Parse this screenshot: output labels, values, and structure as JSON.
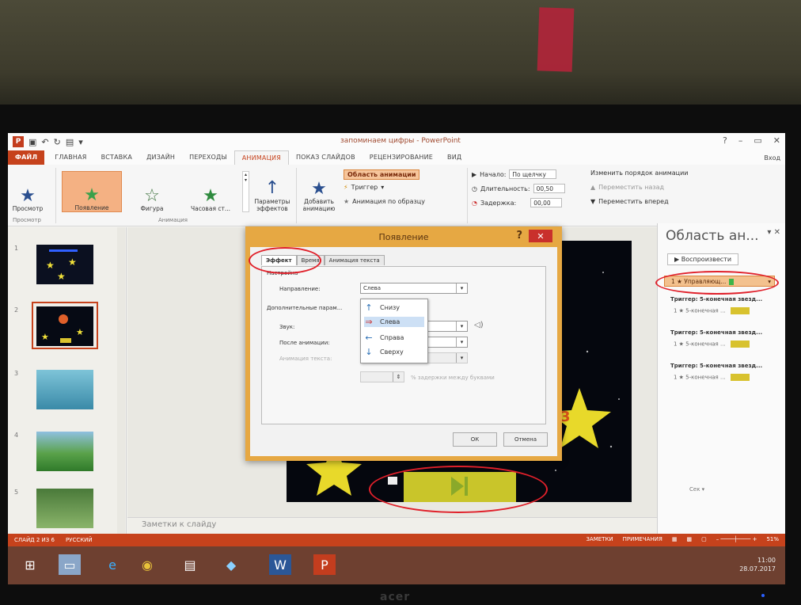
{
  "titlebar": {
    "doc_title": "запоминаем цифры - PowerPoint",
    "help": "?",
    "minimize": "–",
    "maximize": "▭",
    "close": "✕"
  },
  "tabs": {
    "file": "ФАЙЛ",
    "items": [
      "ГЛАВНАЯ",
      "ВСТАВКА",
      "ДИЗАЙН",
      "ПЕРЕХОДЫ",
      "АНИМАЦИЯ",
      "ПОКАЗ СЛАЙДОВ",
      "РЕЦЕНЗИРОВАНИЕ",
      "ВИД"
    ],
    "account": "Вход"
  },
  "ribbon": {
    "preview": "Просмотр",
    "preview_group": "Просмотр",
    "effects": [
      "Появление",
      "Фигура",
      "Часовая ст..."
    ],
    "animation_group": "Анимация",
    "effect_options": "Параметры эффектов",
    "add_animation": "Добавить анимацию",
    "animation_pane": "Область анимации",
    "trigger": "Триггер",
    "animation_painter": "Анимация по образцу",
    "start_label": "Начало:",
    "start_value": "По щелчку",
    "duration_label": "Длительность:",
    "duration_value": "00,50",
    "delay_label": "Задержка:",
    "delay_value": "00,00",
    "reorder_title": "Изменить порядок анимации",
    "move_earlier": "Переместить назад",
    "move_later": "Переместить вперед"
  },
  "slides": {
    "numbers": [
      "1",
      "2",
      "3",
      "4",
      "5"
    ],
    "selected_index": 2
  },
  "notes": {
    "placeholder": "Заметки к слайду"
  },
  "slide": {
    "star_label": "3"
  },
  "animation_pane": {
    "title": "Область ан...",
    "play": "Воспроизвести",
    "selected": "1 ★ Управляющ...",
    "triggers": [
      {
        "title": "Триггер: 5-конечная звезд...",
        "item": "1 ★ 5-конечная ..."
      },
      {
        "title": "Триггер: 5-конечная звезд...",
        "item": "1 ★ 5-конечная ..."
      },
      {
        "title": "Триггер: 5-конечная звезд...",
        "item": "1 ★ 5-конечная ..."
      }
    ],
    "bottom": "Сек ▾"
  },
  "dialog": {
    "title": "Появление",
    "tabs": [
      "Эффект",
      "Время",
      "Анимация текста"
    ],
    "settings_label": "Настройка",
    "direction_label": "Направление:",
    "direction_value": "Слева",
    "extra_label": "Дополнительные парам...",
    "sound_label": "Звук:",
    "after_label": "После анимации:",
    "animate_text_label": "Анимация текста:",
    "delay_text": "% задержки между буквами",
    "options": [
      "Снизу",
      "Слева",
      "Справа",
      "Сверху"
    ],
    "selected_option": 1,
    "ok": "ОК",
    "cancel": "Отмена"
  },
  "statusbar": {
    "slide_info": "СЛАЙД 2 ИЗ 6",
    "language": "РУССКИЙ",
    "notes": "ЗАМЕТКИ",
    "comments": "ПРИМЕЧАНИЯ",
    "zoom": "51%"
  },
  "taskbar": {
    "time": "11:00",
    "date": "28.07.2017"
  },
  "colors": {
    "accent": "#c6421c",
    "dialog_frame": "#e6a843",
    "highlight": "#e0202a"
  }
}
